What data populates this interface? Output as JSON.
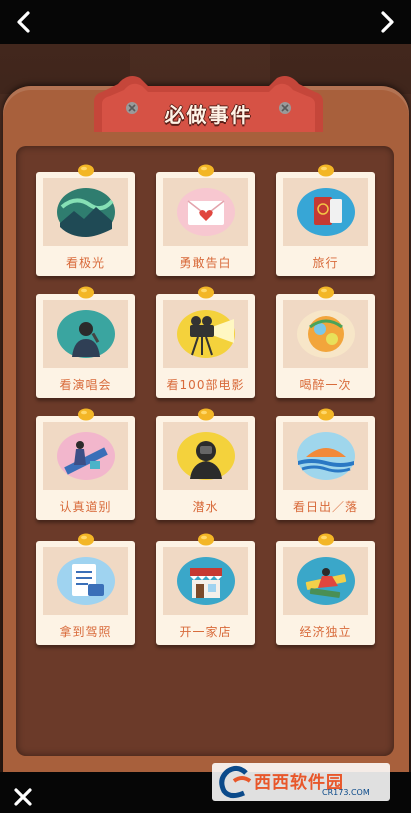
{
  "screen": {
    "title": "必做事件"
  },
  "nav": {
    "back_icon": "chevron-left-icon",
    "forward_icon": "chevron-right-icon",
    "close_icon": "close-icon"
  },
  "items": [
    {
      "label": "看极光",
      "icon": "aurora-icon"
    },
    {
      "label": "勇敢告白",
      "icon": "love-letter-icon"
    },
    {
      "label": "旅行",
      "icon": "passport-icon"
    },
    {
      "label": "看演唱会",
      "icon": "singer-icon"
    },
    {
      "label": "看100部电影",
      "icon": "movie-camera-icon"
    },
    {
      "label": "喝醉一次",
      "icon": "drinks-icon"
    },
    {
      "label": "认真道别",
      "icon": "farewell-icon"
    },
    {
      "label": "潜水",
      "icon": "diver-icon"
    },
    {
      "label": "看日出／落",
      "icon": "sunset-icon"
    },
    {
      "label": "拿到驾照",
      "icon": "license-icon"
    },
    {
      "label": "开一家店",
      "icon": "shop-icon"
    },
    {
      "label": "经济独立",
      "icon": "flying-money-icon"
    }
  ],
  "watermark": {
    "name": "西西软件园",
    "url": "CR173.COM"
  },
  "colors": {
    "accent": "#d86a3a",
    "board": "#a8603c",
    "banner": "#c5463a"
  }
}
